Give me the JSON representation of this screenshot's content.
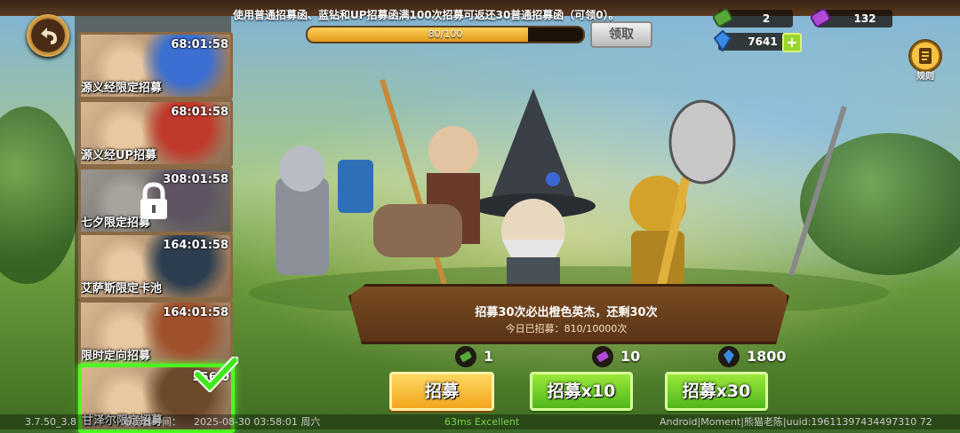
{
  "notice": "使用普通招募函、蓝钻和UP招募函满100次招募可返还30普通招募函（可领0）。",
  "progress": {
    "text": "80/100",
    "fraction": 0.8
  },
  "claim_label": "领取",
  "currencies": {
    "normal_scroll": "2",
    "up_scroll": "132",
    "diamonds": "7641"
  },
  "rules_label": "规则",
  "cards": [
    {
      "timer": "68:01:58",
      "name": "源义经限定招募",
      "locked": false,
      "selected": false,
      "accent": "#3b6fd1"
    },
    {
      "timer": "68:01:58",
      "name": "源义经UP招募",
      "locked": false,
      "selected": false,
      "accent": "#c0392b"
    },
    {
      "timer": "308:01:58",
      "name": "七夕限定招募",
      "locked": true,
      "selected": false,
      "accent": "#9b59b6"
    },
    {
      "timer": "164:01:58",
      "name": "艾萨斯限定卡池",
      "locked": false,
      "selected": false,
      "accent": "#2c3e50"
    },
    {
      "timer": "164:01:58",
      "name": "限时定向招募",
      "locked": false,
      "selected": false,
      "accent": "#a0522d"
    },
    {
      "timer": "356:0",
      "name": "甘泽尔限定招募",
      "locked": false,
      "selected": true,
      "accent": "#6b4a2c"
    }
  ],
  "banner": {
    "line1": "招募30次必出橙色英杰，还剩30次",
    "line2": "今日已招募：810/10000次"
  },
  "costs": [
    {
      "icon": "scroll-icon",
      "value": "1"
    },
    {
      "icon": "purple-scroll-icon",
      "value": "10"
    },
    {
      "icon": "blue-diamond-icon",
      "value": "1800"
    }
  ],
  "buttons": {
    "recruit1": "招募",
    "recruit10": "招募x10",
    "recruit30": "招募x30"
  },
  "footer": {
    "version": "3.7.50_3.8",
    "time_label": "服务器时间：",
    "time": "2025-08-30  03:58:01  周六",
    "fps": "63ms Excellent",
    "device": "Android|Moment|熊猫老陈|uuid:19611397434497310 72"
  },
  "colors": {
    "accent_green": "#4cff20",
    "button_yellow": "#f2a41c",
    "button_green": "#4fb71c"
  }
}
